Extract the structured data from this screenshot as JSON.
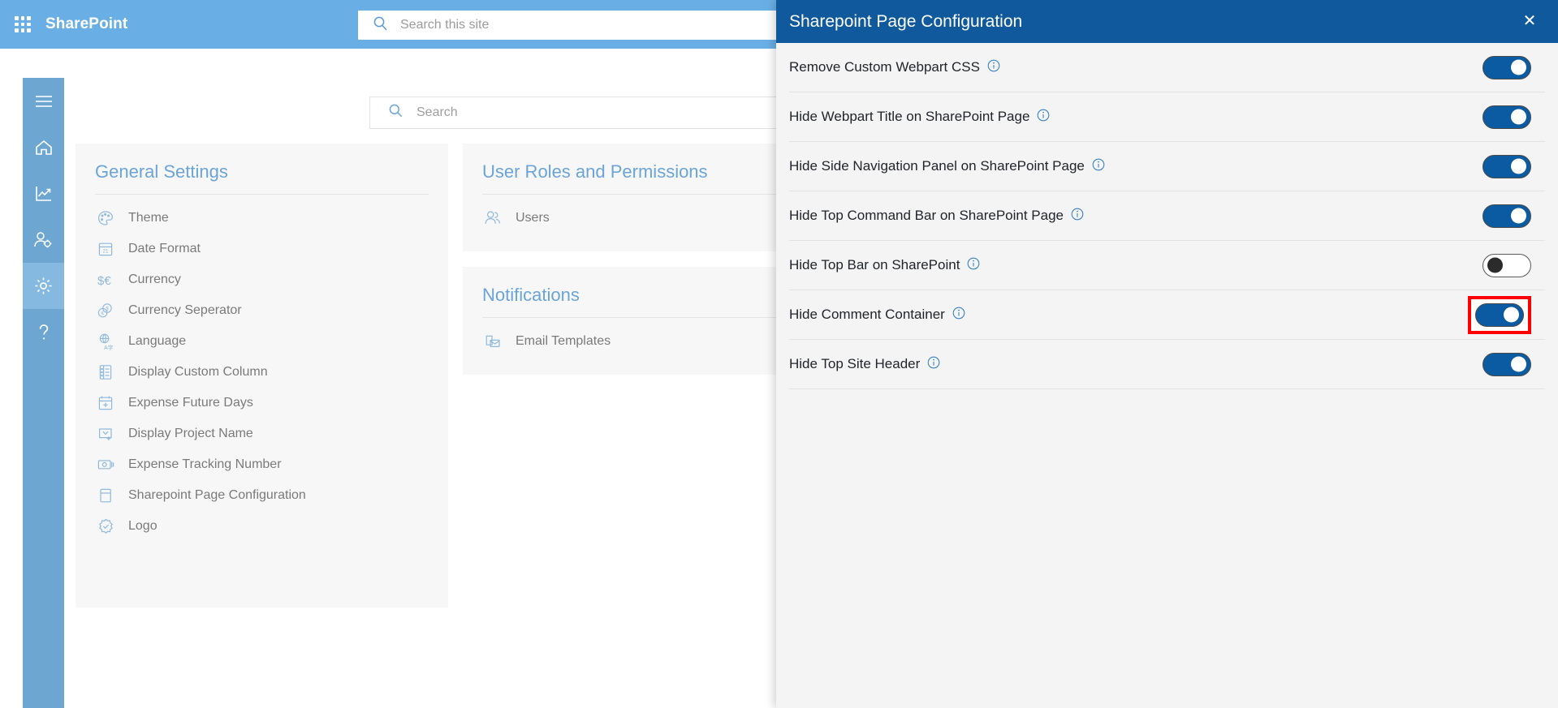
{
  "topbar": {
    "waffle_icon": "app-launcher-icon",
    "brand": "SharePoint",
    "search_icon": "search-icon",
    "search_placeholder": "Search this site",
    "bg_color": "#69afe5"
  },
  "rail": {
    "items": [
      {
        "icon": "hamburger-menu-icon",
        "name": "menu",
        "active": false
      },
      {
        "icon": "home-icon",
        "name": "home",
        "active": false
      },
      {
        "icon": "analytics-chart-icon",
        "name": "reports",
        "active": false
      },
      {
        "icon": "user-settings-icon",
        "name": "user-admin",
        "active": false
      },
      {
        "icon": "gear-icon",
        "name": "settings",
        "active": true
      },
      {
        "icon": "help-question-icon",
        "name": "help",
        "active": false
      }
    ],
    "bg_color": "#6ca6d1",
    "active_color": "#85b9e0"
  },
  "content": {
    "search_icon": "search-icon",
    "search_placeholder": "Search",
    "cards": [
      {
        "title": "General Settings",
        "items": [
          {
            "icon": "palette-icon",
            "label": "Theme"
          },
          {
            "icon": "calendar-date-icon",
            "label": "Date Format"
          },
          {
            "icon": "currency-dollar-euro-icon",
            "label": "Currency"
          },
          {
            "icon": "coins-icon",
            "label": "Currency Seperator"
          },
          {
            "icon": "language-translate-icon",
            "label": "Language"
          },
          {
            "icon": "list-column-icon",
            "label": "Display Custom Column"
          },
          {
            "icon": "calendar-plus-icon",
            "label": "Expense Future Days"
          },
          {
            "icon": "project-name-icon",
            "label": "Display Project Name"
          },
          {
            "icon": "money-bill-icon",
            "label": "Expense Tracking Number"
          },
          {
            "icon": "page-config-icon",
            "label": "Sharepoint Page Configuration"
          },
          {
            "icon": "badge-check-icon",
            "label": "Logo"
          }
        ]
      },
      {
        "title": "User Roles and Permissions",
        "items": [
          {
            "icon": "users-icon",
            "label": "Users"
          }
        ]
      },
      {
        "title": "Notifications",
        "items": [
          {
            "icon": "email-template-icon",
            "label": "Email Templates"
          }
        ]
      }
    ]
  },
  "panel": {
    "title": "Sharepoint Page Configuration",
    "close_icon": "close-icon",
    "header_color": "#10599c",
    "accent_on_color": "#0a5ba1",
    "highlight_color": "#ff0000",
    "rows": [
      {
        "label": "Remove Custom Webpart CSS",
        "info_icon": "info-icon",
        "state": "on",
        "highlighted": false
      },
      {
        "label": "Hide Webpart Title on SharePoint Page",
        "info_icon": "info-icon",
        "state": "on",
        "highlighted": false
      },
      {
        "label": "Hide Side Navigation Panel on SharePoint Page",
        "info_icon": "info-icon",
        "state": "on",
        "highlighted": false
      },
      {
        "label": "Hide Top Command Bar on SharePoint Page",
        "info_icon": "info-icon",
        "state": "on",
        "highlighted": false
      },
      {
        "label": "Hide Top Bar on SharePoint",
        "info_icon": "info-icon",
        "state": "off",
        "highlighted": false
      },
      {
        "label": "Hide Comment Container",
        "info_icon": "info-icon",
        "state": "on",
        "highlighted": true
      },
      {
        "label": "Hide Top Site Header",
        "info_icon": "info-icon",
        "state": "on",
        "highlighted": false
      }
    ]
  }
}
